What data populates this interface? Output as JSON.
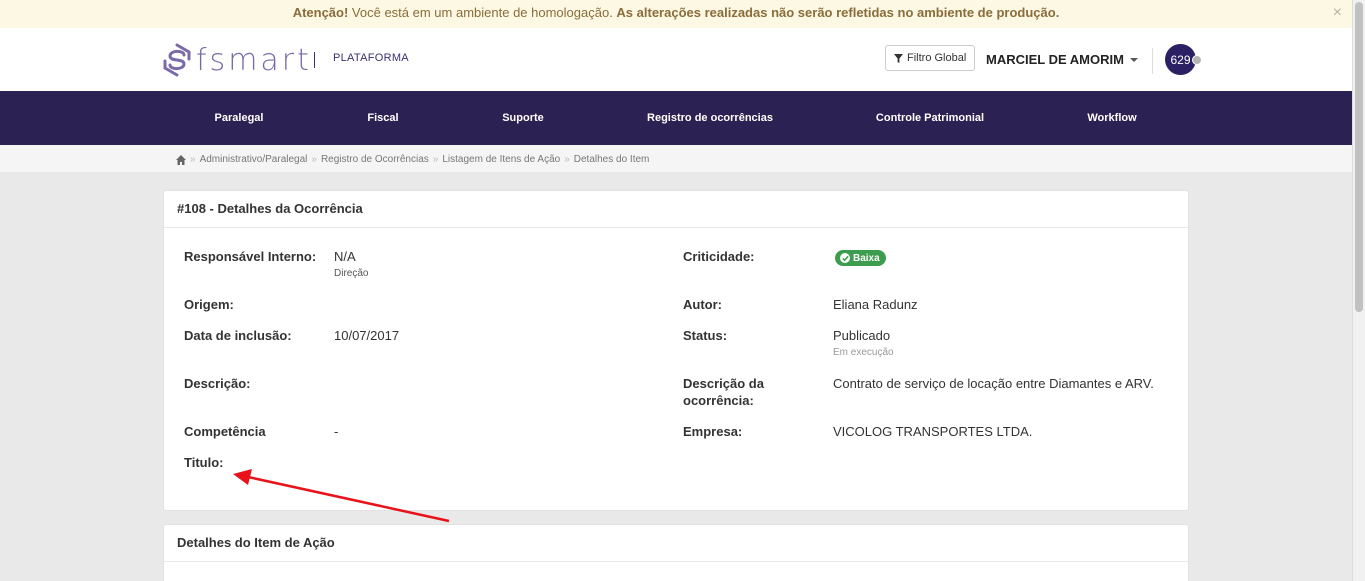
{
  "alert": {
    "strong": "Atenção!",
    "text": " Você está em um ambiente de homologação. ",
    "strong2": "As alterações realizadas não serão refletidas no ambiente de produção.",
    "close": "×"
  },
  "header": {
    "logo_text": "fsmart",
    "platform": "PLATAFORMA",
    "filter_button": "Filtro Global",
    "user_name": "MARCIEL DE AMORIM",
    "badge_count": "629"
  },
  "nav": {
    "items": [
      {
        "label": "Paralegal"
      },
      {
        "label": "Fiscal"
      },
      {
        "label": "Suporte"
      },
      {
        "label": "Registro de ocorrências"
      },
      {
        "label": "Controle Patrimonial"
      },
      {
        "label": "Workflow"
      }
    ]
  },
  "breadcrumb": {
    "items": [
      {
        "label": "Administrativo/Paralegal"
      },
      {
        "label": "Registro de Ocorrências"
      },
      {
        "label": "Listagem de Itens de Ação"
      },
      {
        "label": "Detalhes do Item"
      }
    ],
    "separator": "»"
  },
  "details": {
    "title": "#108 - Detalhes da Ocorrência",
    "responsavel_label": "Responsável Interno:",
    "responsavel_value": "N/A",
    "responsavel_sub": "Direção",
    "criticidade_label": "Criticidade:",
    "criticidade_value": "Baixa",
    "origem_label": "Origem:",
    "autor_label": "Autor:",
    "autor_value": "Eliana Radunz",
    "data_label": "Data de inclusão:",
    "data_value": "10/07/2017",
    "status_label": "Status:",
    "status_value": "Publicado",
    "status_sub": "Em execução",
    "descricao_label": "Descrição:",
    "descricao_ocorrencia_label_1": "Descrição da",
    "descricao_ocorrencia_label_2": "ocorrência:",
    "descricao_ocorrencia_value": "Contrato de serviço de locação entre Diamantes e ARV.",
    "competencia_label": "Competência",
    "competencia_value": "-",
    "empresa_label": "Empresa:",
    "empresa_value": "VICOLOG TRANSPORTES LTDA.",
    "titulo_label": "Titulo:"
  },
  "item_panel": {
    "title": "Detalhes do Item de Ação"
  },
  "colors": {
    "nav_bg": "#2b2152",
    "badge_green": "#3c9d4e",
    "annotation_arrow": "#e8121b"
  }
}
